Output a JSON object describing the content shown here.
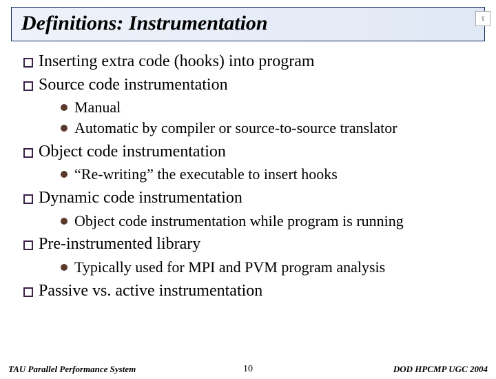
{
  "title": "Definitions: Instrumentation",
  "logo": "τ",
  "bullets": {
    "b0": "Inserting extra code (hooks) into program",
    "b1": "Source code instrumentation",
    "b1_s0": "Manual",
    "b1_s1": "Automatic by compiler or source-to-source translator",
    "b2": "Object code instrumentation",
    "b2_s0": "“Re-writing” the executable to insert hooks",
    "b3": "Dynamic code instrumentation",
    "b3_s0": "Object code instrumentation while program is running",
    "b4": "Pre-instrumented library",
    "b4_s0": "Typically used for MPI and PVM program analysis",
    "b5": "Passive vs. active instrumentation"
  },
  "footer": {
    "left": "TAU Parallel Performance System",
    "center": "10",
    "right": "DOD HPCMP UGC 2004"
  }
}
